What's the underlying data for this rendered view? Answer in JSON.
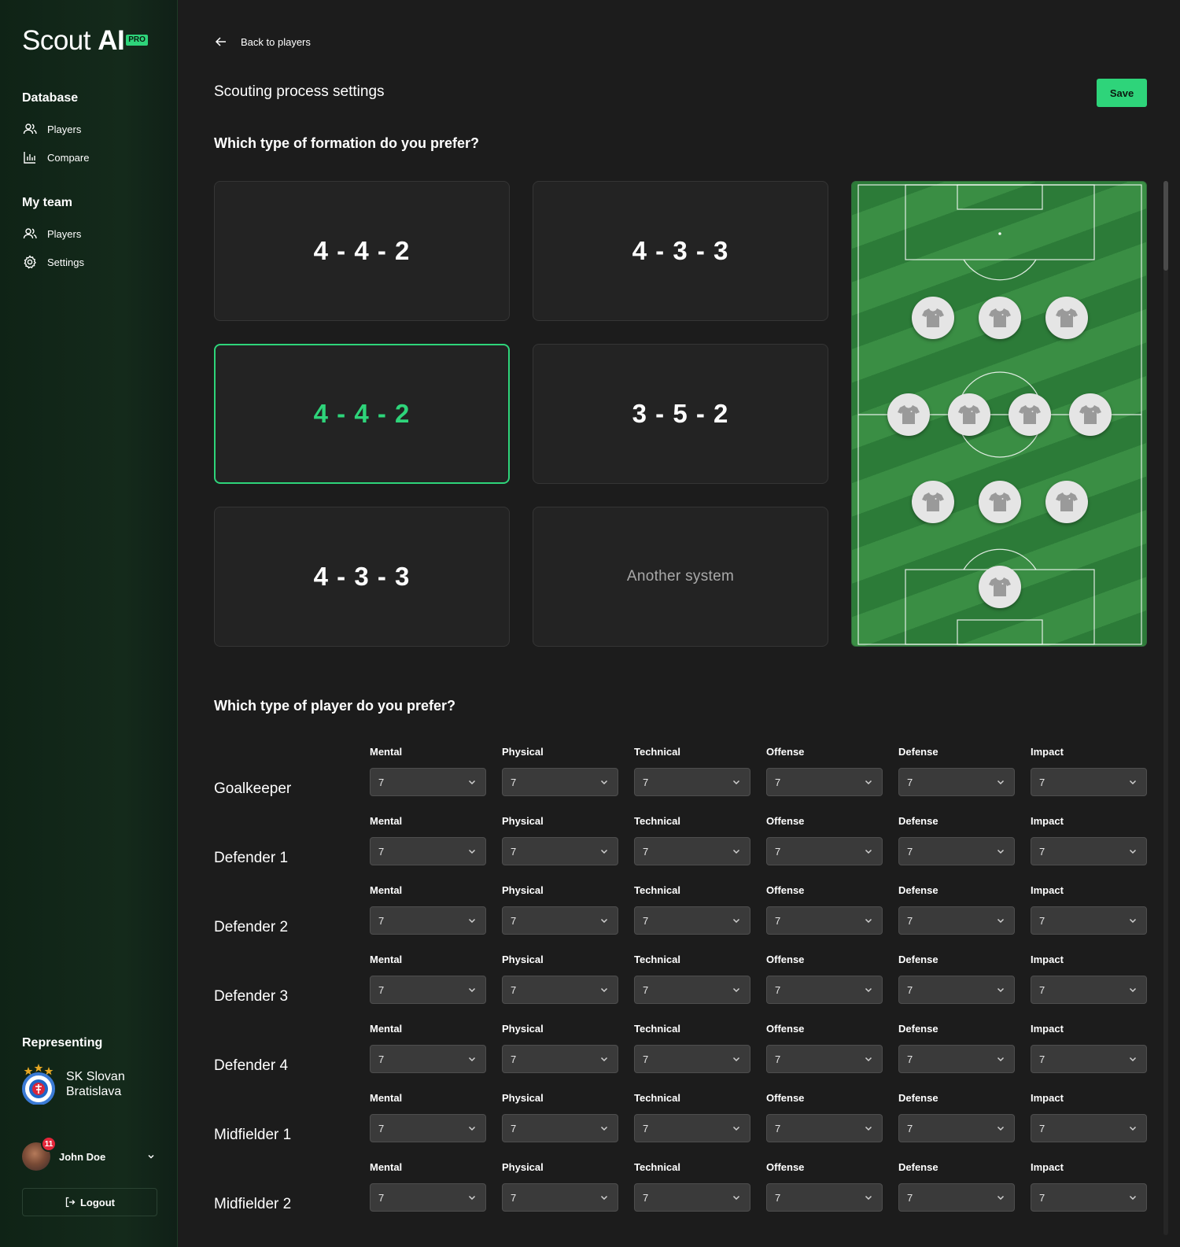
{
  "app": {
    "logo_text_light": "Scout ",
    "logo_text_bold": "AI",
    "logo_badge": "PRO"
  },
  "sidebar": {
    "database": {
      "heading": "Database",
      "items": [
        {
          "label": "Players",
          "icon": "users-icon"
        },
        {
          "label": "Compare",
          "icon": "bar-chart-icon"
        }
      ]
    },
    "my_team": {
      "heading": "My team",
      "items": [
        {
          "label": "Players",
          "icon": "users-icon"
        },
        {
          "label": "Settings",
          "icon": "gear-icon"
        }
      ]
    },
    "representing_heading": "Representing",
    "club_name_line1": "SK Slovan",
    "club_name_line2": "Bratislava",
    "user": {
      "name": "John Doe",
      "notifications": "11"
    },
    "logout_label": "Logout"
  },
  "header": {
    "back_label": "Back to players",
    "title": "Scouting process settings",
    "save_label": "Save"
  },
  "formation_question": "Which type of formation do you prefer?",
  "formations": [
    {
      "label": "4 - 4 - 2",
      "selected": false
    },
    {
      "label": "4 - 3 - 3",
      "selected": false
    },
    {
      "label": "4 - 4 - 2",
      "selected": true
    },
    {
      "label": "3 - 5 - 2",
      "selected": false
    },
    {
      "label": "4 - 3 - 3",
      "selected": false
    },
    {
      "label": "Another system",
      "selected": false
    }
  ],
  "player_question": "Which type of player do you prefer?",
  "attributes": [
    "Mental",
    "Physical",
    "Technical",
    "Offense",
    "Defense",
    "Impact"
  ],
  "players": [
    {
      "position": "Goalkeeper",
      "values": [
        "7",
        "7",
        "7",
        "7",
        "7",
        "7"
      ]
    },
    {
      "position": "Defender 1",
      "values": [
        "7",
        "7",
        "7",
        "7",
        "7",
        "7"
      ]
    },
    {
      "position": "Defender 2",
      "values": [
        "7",
        "7",
        "7",
        "7",
        "7",
        "7"
      ]
    },
    {
      "position": "Defender 3",
      "values": [
        "7",
        "7",
        "7",
        "7",
        "7",
        "7"
      ]
    },
    {
      "position": "Defender 4",
      "values": [
        "7",
        "7",
        "7",
        "7",
        "7",
        "7"
      ]
    },
    {
      "position": "Midfielder 1",
      "values": [
        "7",
        "7",
        "7",
        "7",
        "7",
        "7"
      ]
    },
    {
      "position": "Midfielder 2",
      "values": [
        "7",
        "7",
        "7",
        "7",
        "7",
        "7"
      ]
    }
  ],
  "colors": {
    "accent": "#2ed47a",
    "background": "#1c1c1c",
    "card": "#232323",
    "sidebar": "#132a1b"
  }
}
